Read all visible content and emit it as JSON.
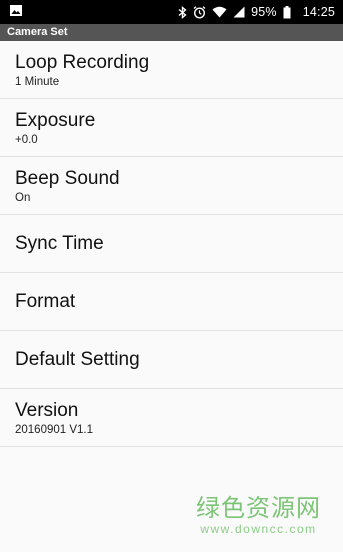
{
  "status_bar": {
    "icons": [
      "image-icon",
      "bluetooth-icon",
      "alarm-icon",
      "wifi-icon",
      "signal-icon",
      "battery-icon"
    ],
    "battery": "95%",
    "time": "14:25"
  },
  "app_bar": {
    "title": "Camera Set"
  },
  "settings": [
    {
      "title": "Loop Recording",
      "summary": "1 Minute"
    },
    {
      "title": "Exposure",
      "summary": "+0.0"
    },
    {
      "title": "Beep Sound",
      "summary": "On"
    },
    {
      "title": "Sync Time",
      "summary": ""
    },
    {
      "title": "Format",
      "summary": ""
    },
    {
      "title": "Default Setting",
      "summary": ""
    },
    {
      "title": "Version",
      "summary": "20160901 V1.1"
    }
  ],
  "watermark": {
    "main": "绿色资源网",
    "sub": "www.downcc.com"
  },
  "colors": {
    "status_bar": "#000000",
    "app_bar": "#555555",
    "background": "#fafafa",
    "watermark": "#7cc576"
  }
}
